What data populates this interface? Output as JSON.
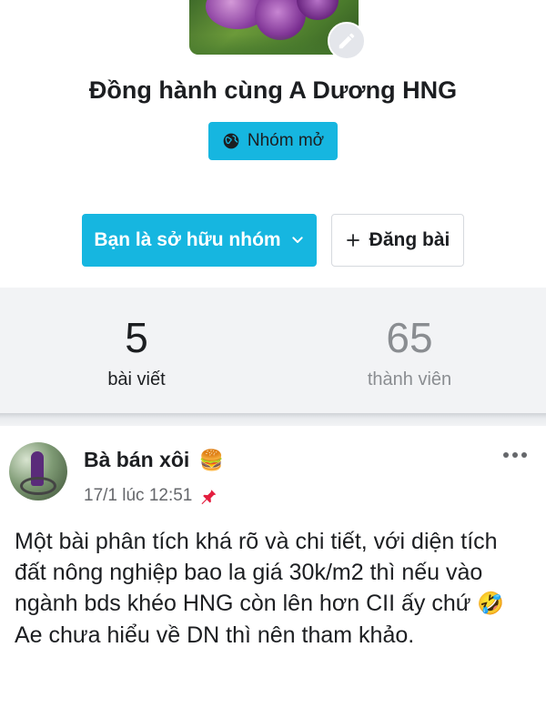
{
  "group": {
    "title": "Đồng hành cùng A Dương HNG",
    "privacy_label": "Nhóm mở",
    "privacy_icon": "globe-icon",
    "edit_icon": "pencil-icon"
  },
  "actions": {
    "owner_label": "Bạn là sở hữu nhóm",
    "owner_icon": "chevron-down-icon",
    "post_label": "Đăng bài",
    "post_icon": "plus-icon"
  },
  "stats": {
    "posts_count": "5",
    "posts_label": "bài viết",
    "members_count": "65",
    "members_label": "thành viên"
  },
  "post": {
    "author": "Bà bán xôi",
    "author_emoji": "🍔",
    "timestamp": "17/1 lúc 12:51",
    "pin_icon": "pin-icon",
    "more_icon": "more-icon",
    "body_part1": "Một bài phân tích khá rõ và chi tiết, với diện tích đất nông nghiệp bao la giá 30k/m2 thì nếu vào ngành bds khéo HNG còn lên hơn CII ấy chứ",
    "body_emoji": "🤣",
    "body_part2": "Ae chưa hiểu về DN thì nên tham khảo."
  },
  "colors": {
    "accent": "#16b6e0",
    "stats_bg": "#f2f3f5",
    "muted_text": "#8a8d91",
    "pin_red": "#e41e3f"
  }
}
